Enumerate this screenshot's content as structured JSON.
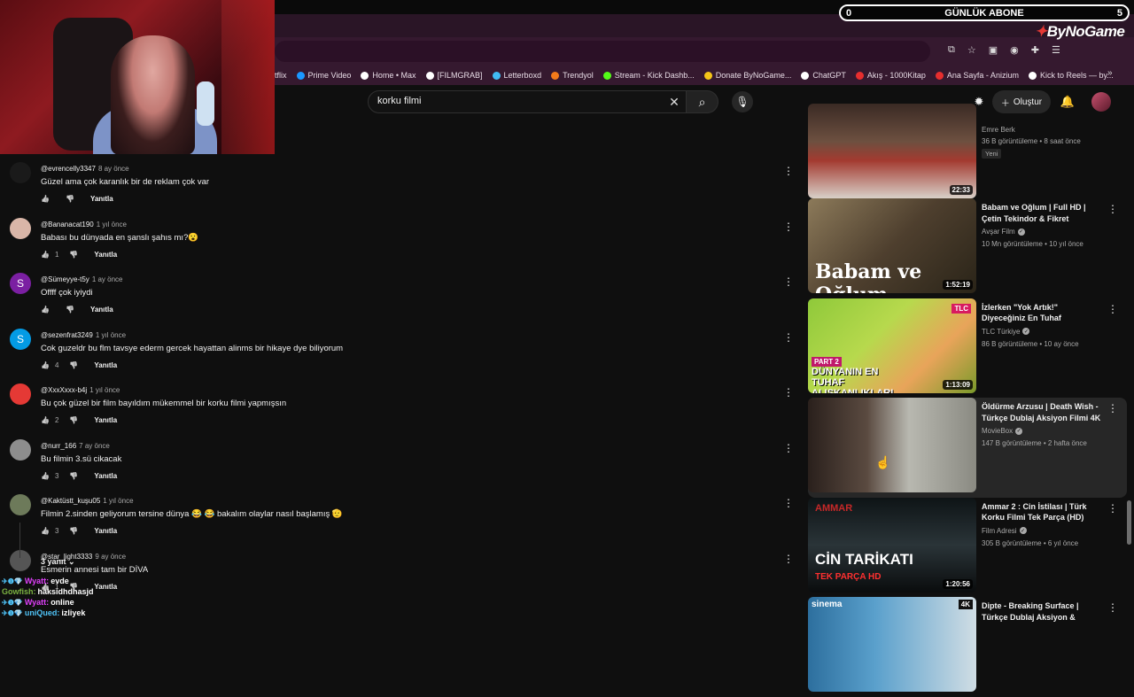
{
  "overlay": {
    "abone_left": "0",
    "abone_label": "GÜNLÜK ABONE",
    "abone_right": "5",
    "brand": "ByNoGame"
  },
  "bookmarks": [
    {
      "label": "tflix",
      "color": ""
    },
    {
      "label": "Prime Video",
      "color": "#1a98ff"
    },
    {
      "label": "Home • Max",
      "color": "#ffffff"
    },
    {
      "label": "[FILMGRAB]",
      "color": "#ffffff"
    },
    {
      "label": "Letterboxd",
      "color": "#40bcf4"
    },
    {
      "label": "Trendyol",
      "color": "#f27a1a"
    },
    {
      "label": "Stream - Kick Dashb...",
      "color": "#53fc18"
    },
    {
      "label": "Donate ByNoGame...",
      "color": "#f5c518"
    },
    {
      "label": "ChatGPT",
      "color": "#ffffff"
    },
    {
      "label": "Akış - 1000Kitap",
      "color": "#e62e2e"
    },
    {
      "label": "Ana Sayfa - Anizium",
      "color": "#e62e2e"
    },
    {
      "label": "Kick to Reels — by...",
      "color": "#ffffff"
    }
  ],
  "header": {
    "search_value": "korku filmi",
    "create_label": "Oluştur"
  },
  "comments": [
    {
      "author": "@evrencelly3347",
      "time": "8 ay önce",
      "text": "Güzel ama çok karanlık bir de reklam çok var",
      "likes": "",
      "reply": "Yanıtla",
      "avatar_color": "#1a1a1a",
      "avatar_letter": ""
    },
    {
      "author": "@Bananacat190",
      "time": "1 yıl önce",
      "text": "Babası bu dünyada en şanslı şahıs mı?😮",
      "likes": "1",
      "reply": "Yanıtla",
      "avatar_color": "#d9b6a8",
      "avatar_letter": ""
    },
    {
      "author": "@Sümeyye-t5y",
      "time": "1 ay önce",
      "text": "Offff çok iyiydi",
      "likes": "",
      "reply": "Yanıtla",
      "avatar_color": "#7b1fa2",
      "avatar_letter": "S"
    },
    {
      "author": "@sezenfrat3249",
      "time": "1 yıl önce",
      "text": "Cok guzeldr bu flm tavsye ederm gercek hayattan alinms bir hikaye dye biliyorum",
      "likes": "4",
      "reply": "Yanıtla",
      "avatar_color": "#039be5",
      "avatar_letter": "S"
    },
    {
      "author": "@XxxXxxx-b4j",
      "time": "1 yıl önce",
      "text": "Bu çok güzel bir film bayıldım mükemmel bir korku filmi yapmışsın",
      "likes": "2",
      "reply": "Yanıtla",
      "avatar_color": "#e53935",
      "avatar_letter": ""
    },
    {
      "author": "@nurr_166",
      "time": "7 ay önce",
      "text": "Bu filmin 3.sü cikacak",
      "likes": "3",
      "reply": "Yanıtla",
      "avatar_color": "#8d8d8d",
      "avatar_letter": ""
    },
    {
      "author": "@Kaktüstt_kuşu05",
      "time": "1 yıl önce",
      "text": "Filmin 2.sinden geliyorum tersine dünya 😂 😂 bakalım olaylar nasıl başlamış 🫡",
      "likes": "3",
      "reply": "Yanıtla",
      "avatar_color": "#6d7a5a",
      "avatar_letter": ""
    },
    {
      "author": "@star_light3333",
      "time": "9 ay önce",
      "text": "Esmerin annesi tam bir DİVA",
      "likes": "1",
      "reply": "Yanıtla",
      "avatar_color": "#555555",
      "avatar_letter": ""
    }
  ],
  "replies_toggle": "3 yanıt",
  "chat": [
    {
      "user": "Wyatt:",
      "msg": "evde",
      "color": "#e040fb",
      "badges": true
    },
    {
      "user": "Gowfish:",
      "msg": "haksidhdhasjd",
      "color": "#7cb342",
      "badges": false
    },
    {
      "user": "Wyatt:",
      "msg": "online",
      "color": "#e040fb",
      "badges": true
    },
    {
      "user": "uniQued:",
      "msg": "izliyek",
      "color": "#4fc3f7",
      "badges": true
    }
  ],
  "videos": [
    {
      "title": "",
      "channel": "Emre Berk",
      "verified": false,
      "meta": "36 B görüntüleme • 8 saat önce",
      "badge": "Yeni",
      "duration": "22:33",
      "thumb": "kids"
    },
    {
      "title": "Babam ve Oğlum | Full HD | Çetin Tekindor & Fikret Kuşkan...",
      "channel": "Avşar Film",
      "verified": true,
      "meta": "10 Mn görüntüleme • 10 yıl önce",
      "badge": "",
      "duration": "1:52:19",
      "thumb": "babam",
      "thumb_text": "Babam ve Oğlum"
    },
    {
      "title": "İzlerken \"Yok Artık!\" Diyeceğiniz En Tuhaf Bağımlılıklar Serisi | ...",
      "channel": "TLC Türkiye",
      "verified": true,
      "meta": "86 B görüntüleme • 10 ay önce",
      "badge": "",
      "duration": "1:13:09",
      "thumb": "tlc",
      "thumb_text": "DÜNYANIN EN TUHAF ALIŞKANLIKLARI",
      "thumb_tag": "PART 2",
      "thumb_logo": "TLC"
    },
    {
      "title": "Öldürme Arzusu | Death Wish - Türkçe Dublaj Aksiyon Filmi 4K",
      "channel": "MovieBox",
      "verified": true,
      "meta": "147 B görüntüleme • 2 hafta önce",
      "badge": "",
      "duration": "",
      "thumb": "death"
    },
    {
      "title": "Ammar 2 : Cin İstilası | Türk Korku Filmi Tek Parça (HD)",
      "channel": "Film Adresi",
      "verified": true,
      "meta": "305 B görüntüleme • 6 yıl önce",
      "badge": "",
      "duration": "1:20:56",
      "thumb": "ammar",
      "thumb_text": "CİN TARİKATI",
      "thumb_sub": "TEK PARÇA HD",
      "thumb_logo": "AMMAR"
    },
    {
      "title": "Dipte - Breaking Surface | Türkçe Dublaj Aksiyon & Gerili...",
      "channel": "",
      "verified": false,
      "meta": "",
      "badge": "",
      "duration": "",
      "thumb": "dipte",
      "thumb_logo": "sinema",
      "thumb_tag": "4K"
    }
  ]
}
